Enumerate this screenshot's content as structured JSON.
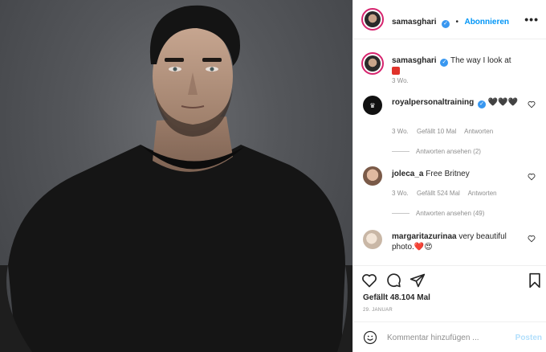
{
  "post": {
    "username": "samasghari",
    "follow_label": "Abonnieren",
    "more_label": "•••"
  },
  "caption": {
    "username": "samasghari",
    "text": "The way I look at",
    "time": "3 Wo."
  },
  "comments": [
    {
      "username": "royalpersonaltraining",
      "text": "🖤🖤🖤",
      "time": "3 Wo.",
      "likes": "Gefällt 10 Mal",
      "reply": "Antworten",
      "view_replies": "Antworten ansehen (2)"
    },
    {
      "username": "joleca_a",
      "text": "Free Britney",
      "time": "3 Wo.",
      "likes": "Gefällt 524 Mal",
      "reply": "Antworten",
      "view_replies": "Antworten ansehen (49)"
    },
    {
      "username": "margaritazurinaa",
      "text": "very beautiful photo.❤️😍",
      "time": "",
      "likes": "",
      "reply": "",
      "view_replies": ""
    }
  ],
  "actions": {
    "likes_text": "Gefällt 48.104 Mal",
    "date": "29. JANUAR"
  },
  "add_comment": {
    "placeholder": "Kommentar hinzufügen ...",
    "post_label": "Posten"
  },
  "colors": {
    "link": "#0095f6",
    "verified": "#3897f0",
    "heart": "#ed4956"
  }
}
